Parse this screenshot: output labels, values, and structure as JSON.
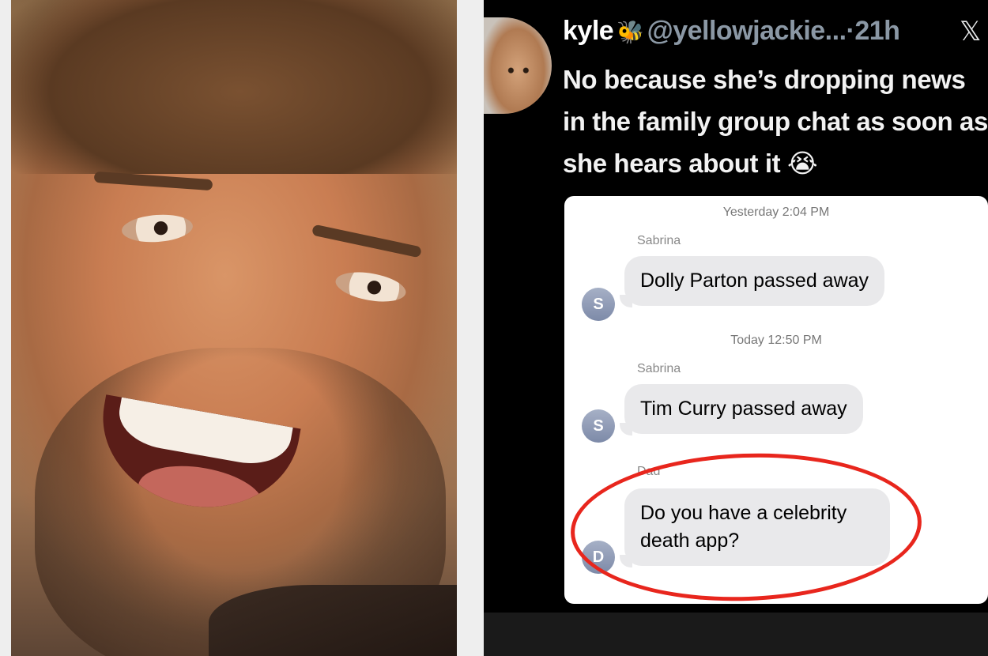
{
  "tweet": {
    "display_name": "kyle",
    "badge_emoji": "🐝",
    "handle": "@yellowjackie...",
    "separator": "·",
    "time": "21h",
    "platform_icon": "x-logo-icon",
    "text": "No because she’s dropping news in the family group chat as soon as she hears about it",
    "text_emoji": "😭"
  },
  "chat": {
    "groups": [
      {
        "timestamp": "Yesterday 2:04 PM",
        "sender": "Sabrina",
        "avatar_letter": "S",
        "message": "Dolly Parton passed away"
      },
      {
        "timestamp": "Today 12:50 PM",
        "sender": "Sabrina",
        "avatar_letter": "S",
        "message": "Tim Curry passed away"
      },
      {
        "sender": "Dad",
        "avatar_letter": "D",
        "message": "Do you have a celebrity death app?"
      }
    ]
  },
  "colors": {
    "highlight_circle": "#e8261d",
    "bubble": "#e9e9eb",
    "tweet_background": "#000000"
  }
}
